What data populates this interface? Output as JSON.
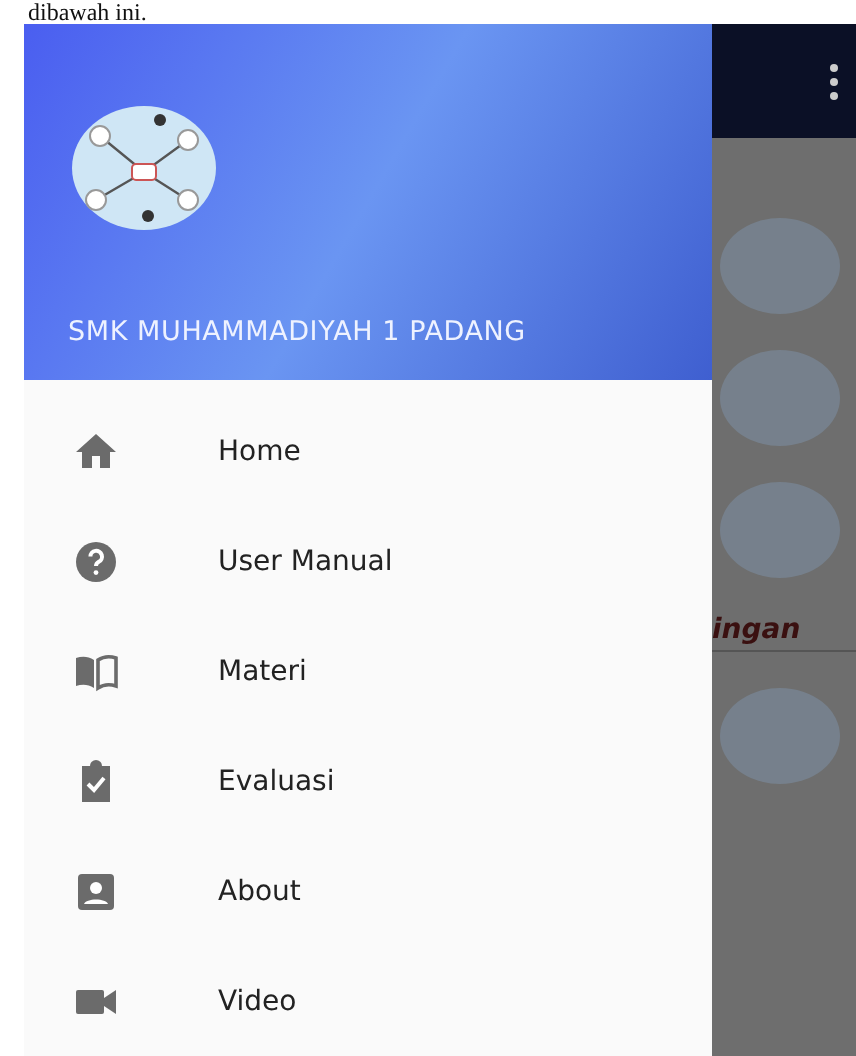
{
  "page_text": "dibawah ini.",
  "drawer": {
    "header_title": "SMK MUHAMMADIYAH 1 PADANG",
    "items": [
      {
        "label": "Home"
      },
      {
        "label": "User Manual"
      },
      {
        "label": "Materi"
      },
      {
        "label": "Evaluasi"
      },
      {
        "label": "About"
      },
      {
        "label": "Video"
      }
    ]
  },
  "background_content": {
    "text_fragment": "ingan"
  }
}
